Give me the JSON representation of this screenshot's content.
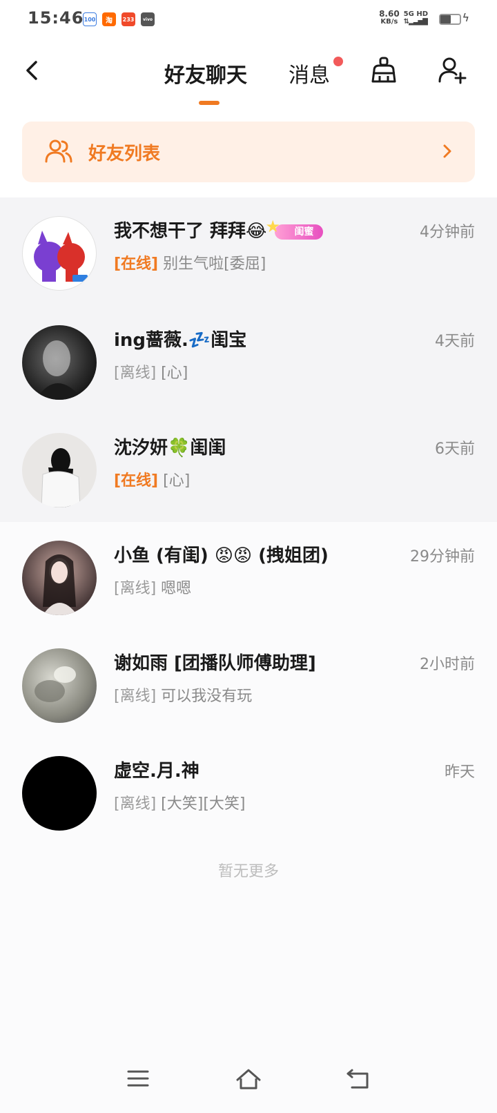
{
  "status_bar": {
    "time": "15:46",
    "apps": [
      {
        "icon": "app-100-icon",
        "text": "100",
        "color": "#3a7be0"
      },
      {
        "icon": "taobao-icon",
        "text": "淘",
        "color": "#ff6a00"
      },
      {
        "icon": "game-233-icon",
        "text": "233",
        "color": "#f04a2a"
      },
      {
        "icon": "vivo-icon",
        "text": "vivo",
        "color": "#555555"
      }
    ],
    "net_speed": "8.60",
    "net_unit": "KB/s",
    "network": "5G HD"
  },
  "header": {
    "tab_chat": "好友聊天",
    "tab_messages": "消息",
    "accent_color": "#f07a22"
  },
  "friend_list": {
    "label": "好友列表"
  },
  "chats": [
    {
      "name": "我不想干了  拜拜😂",
      "tag": "闺蜜",
      "time": "4分钟前",
      "status": "[在线]",
      "preview": "别生气啦[委屈]"
    },
    {
      "name": "ing蔷薇.💤闺宝",
      "time": "4天前",
      "status": "[离线]",
      "preview": "[心]"
    },
    {
      "name": "沈汐妍🍀闺闺",
      "time": "6天前",
      "status": "[在线]",
      "preview": "[心]"
    },
    {
      "name": "小鱼 (有闺) 😡😡 (拽姐团)",
      "time": "29分钟前",
      "status": "[离线]",
      "preview": "嗯嗯"
    },
    {
      "name": "谢如雨 [团播队师傅助理]",
      "time": "2小时前",
      "status": "[离线]",
      "preview": "可以我没有玩"
    },
    {
      "name": "虚空.月.神",
      "time": "昨天",
      "status": "[离线]",
      "preview": "[大笑][大笑]"
    }
  ],
  "footer": {
    "no_more": "暂无更多"
  }
}
